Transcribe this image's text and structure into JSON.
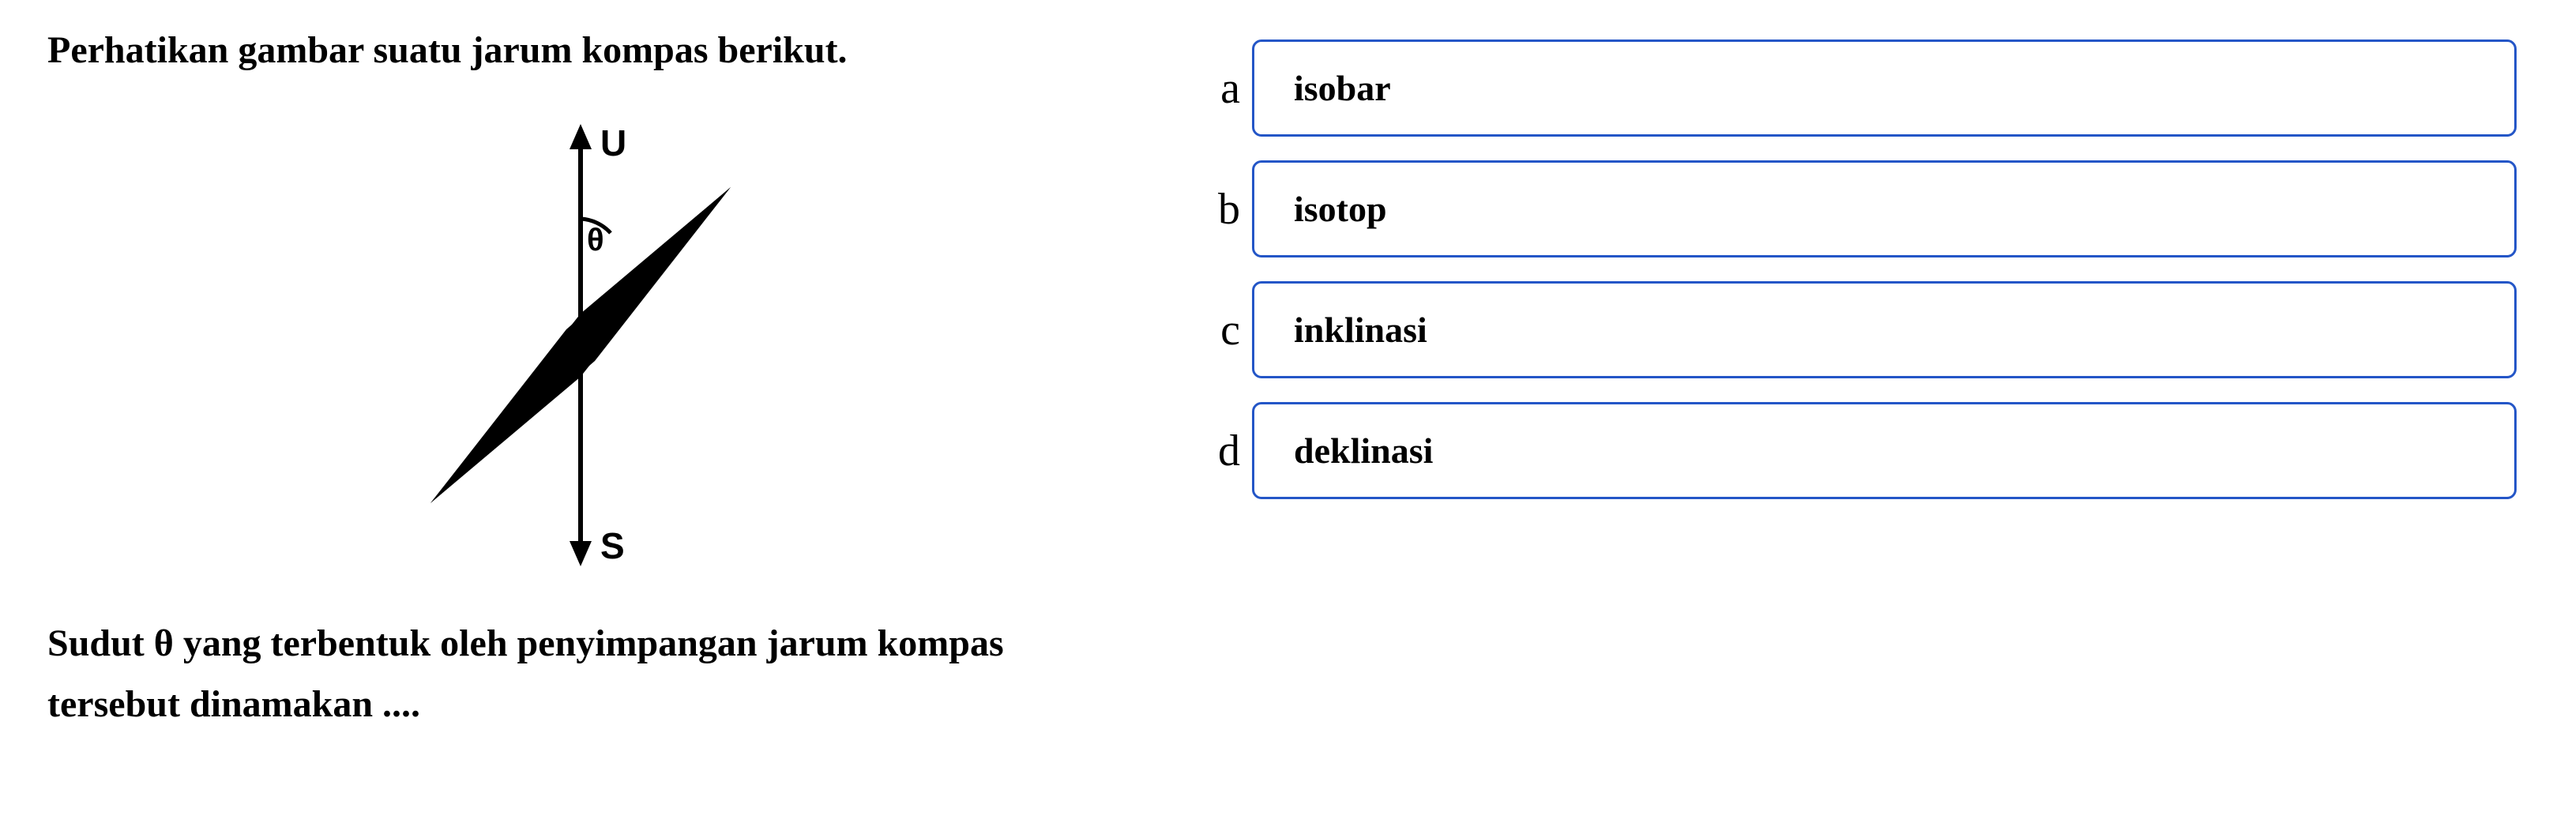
{
  "question": {
    "intro": "Perhatikan gambar suatu jarum kompas berikut.",
    "conclusion_line1": "Sudut θ yang terbentuk oleh penyimpangan jarum kompas",
    "conclusion_line2": "tersebut dinamakan ...."
  },
  "diagram": {
    "north_label": "U",
    "south_label": "S",
    "angle_label": "θ"
  },
  "options": [
    {
      "letter": "a",
      "text": "isobar"
    },
    {
      "letter": "b",
      "text": "isotop"
    },
    {
      "letter": "c",
      "text": "inklinasi"
    },
    {
      "letter": "d",
      "text": "deklinasi"
    }
  ]
}
